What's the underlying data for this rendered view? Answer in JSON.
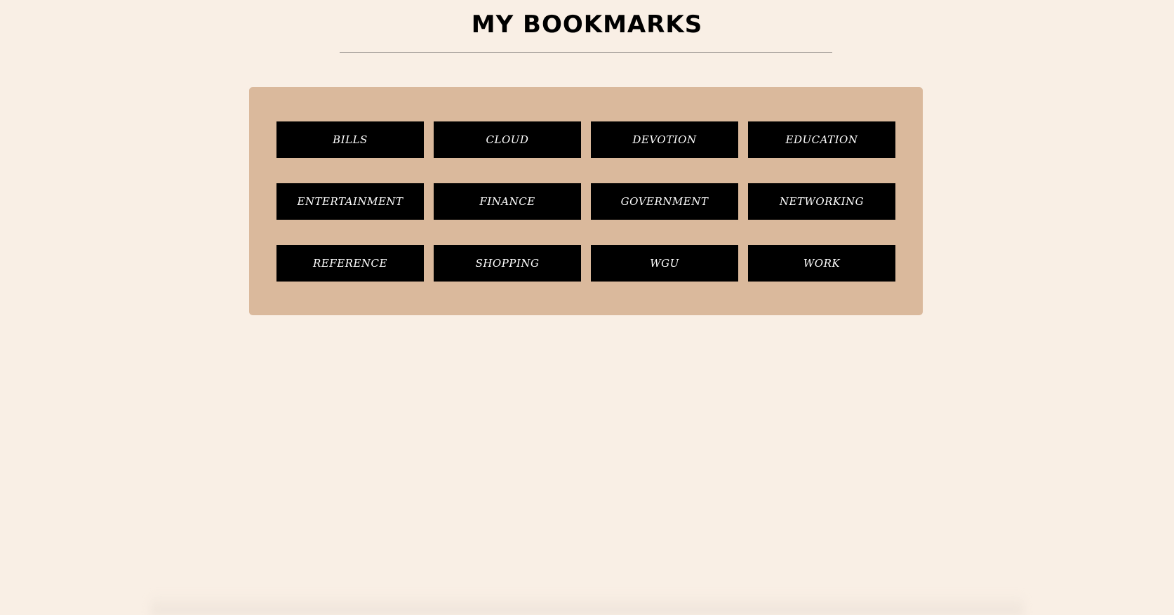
{
  "header": {
    "title": "MY BOOKMARKS"
  },
  "bookmarks": [
    {
      "label": "BILLS"
    },
    {
      "label": "CLOUD"
    },
    {
      "label": "DEVOTION"
    },
    {
      "label": "EDUCATION"
    },
    {
      "label": "ENTERTAINMENT"
    },
    {
      "label": "FINANCE"
    },
    {
      "label": "GOVERNMENT"
    },
    {
      "label": "NETWORKING"
    },
    {
      "label": "REFERENCE"
    },
    {
      "label": "SHOPPING"
    },
    {
      "label": "WGU"
    },
    {
      "label": "WORK"
    }
  ],
  "colors": {
    "page_background": "#f9efe5",
    "panel_background": "#dab99c",
    "button_background": "#000000",
    "button_text": "#ffffff"
  }
}
